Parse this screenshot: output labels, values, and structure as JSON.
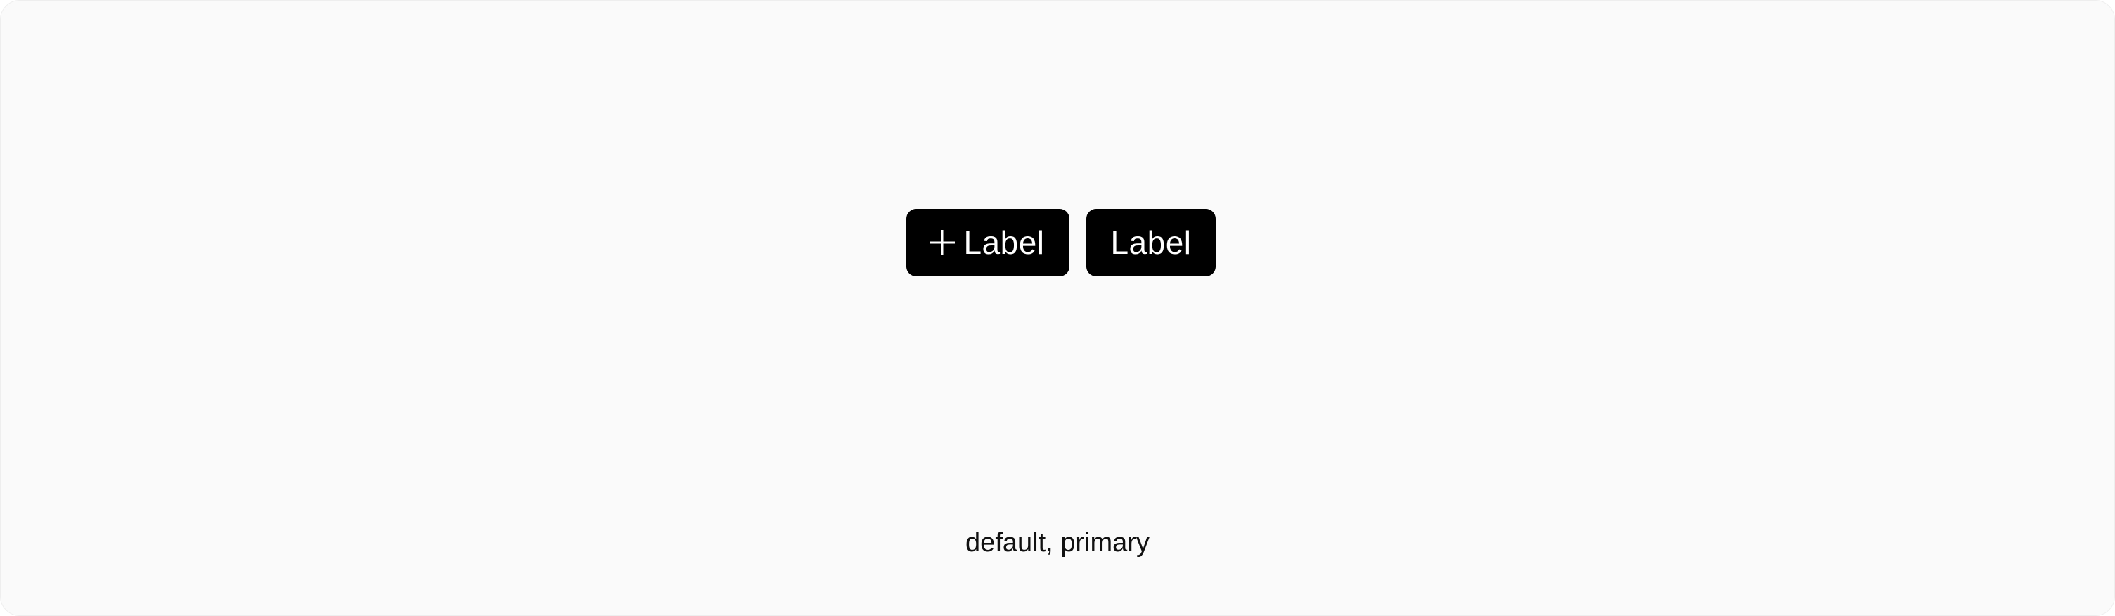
{
  "buttons": {
    "with_icon": {
      "icon": "plus-icon",
      "label": "Label"
    },
    "plain": {
      "label": "Label"
    },
    "background": "#000000",
    "text_color": "#ffffff"
  },
  "caption": "default, primary",
  "canvas_background": "#fafafa"
}
